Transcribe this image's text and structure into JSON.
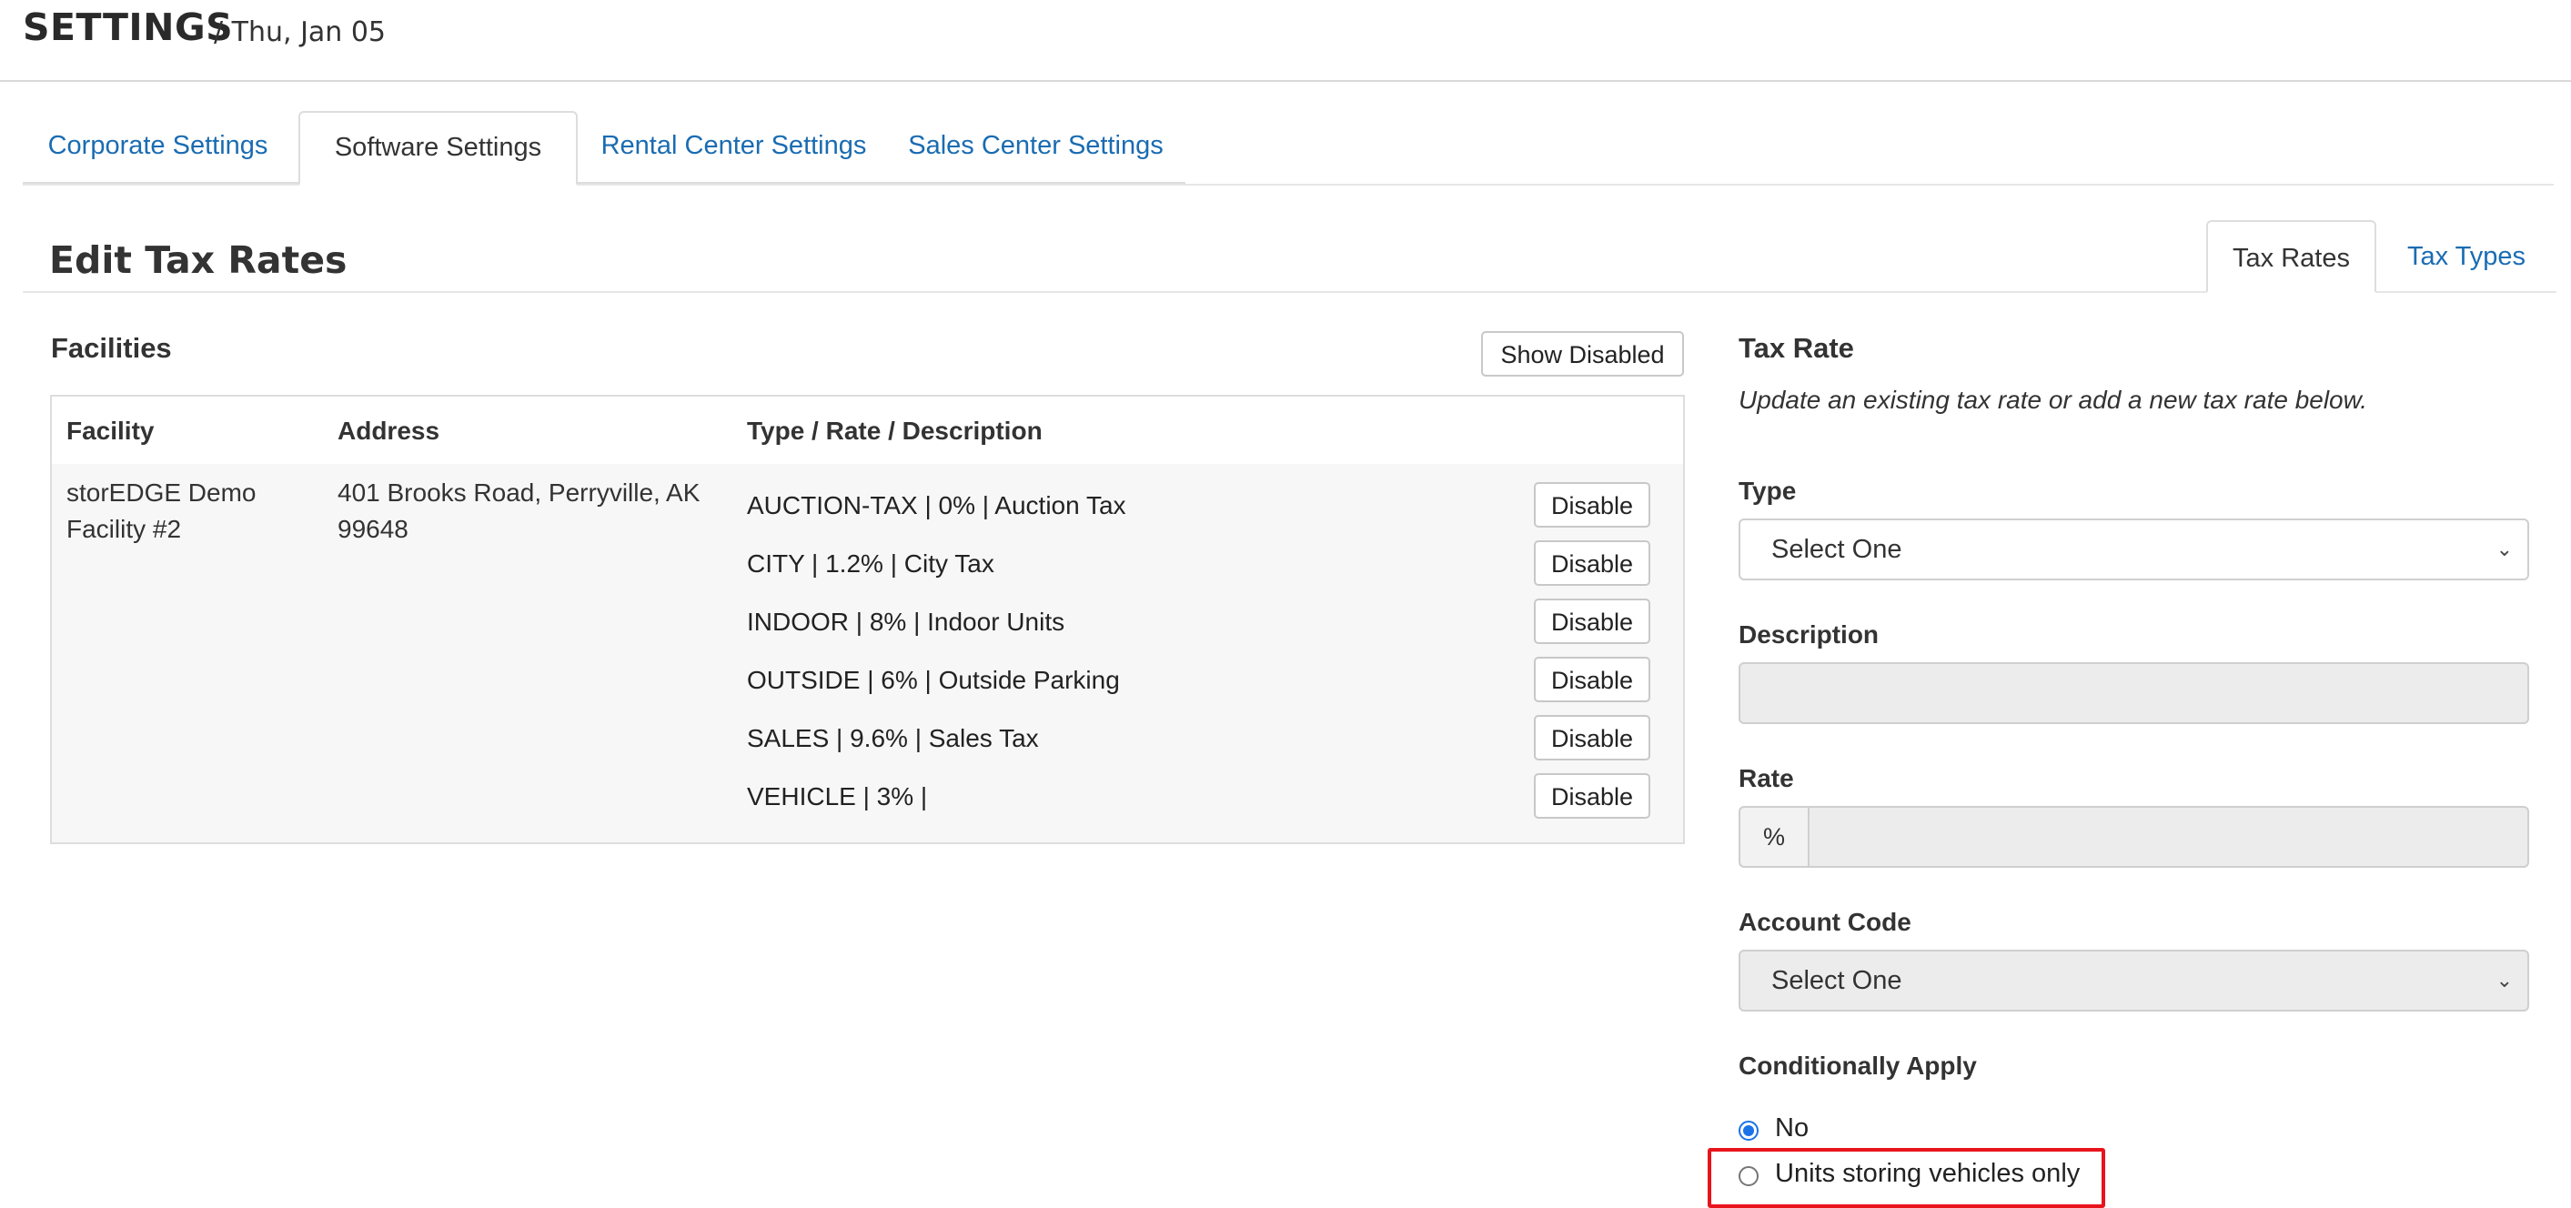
{
  "header": {
    "title": "SETTINGS",
    "date": "/ Thu, Jan 05"
  },
  "main_tabs": [
    {
      "label": "Corporate Settings",
      "active": false
    },
    {
      "label": "Software Settings",
      "active": true
    },
    {
      "label": "Rental Center Settings",
      "active": false
    },
    {
      "label": "Sales Center Settings",
      "active": false
    }
  ],
  "section": {
    "title": "Edit Tax Rates",
    "tabs": [
      {
        "label": "Tax Rates",
        "active": true
      },
      {
        "label": "Tax Types",
        "active": false
      }
    ]
  },
  "facilities": {
    "title": "Facilities",
    "show_disabled_label": "Show Disabled",
    "columns": [
      "Facility",
      "Address",
      "Type / Rate / Description"
    ],
    "rows": [
      {
        "facility_line1": "storEDGE Demo",
        "facility_line2": "Facility #2",
        "address_line1": "401 Brooks Road, Perryville, AK",
        "address_line2": "99648",
        "rates": [
          {
            "text": "AUCTION-TAX | 0% | Auction Tax",
            "button": "Disable"
          },
          {
            "text": "CITY | 1.2% | City Tax",
            "button": "Disable"
          },
          {
            "text": "INDOOR | 8% | Indoor Units",
            "button": "Disable"
          },
          {
            "text": "OUTSIDE | 6% | Outside Parking",
            "button": "Disable"
          },
          {
            "text": "SALES | 9.6% | Sales Tax",
            "button": "Disable"
          },
          {
            "text": "VEHICLE | 3% |",
            "button": "Disable"
          }
        ]
      }
    ]
  },
  "form": {
    "title": "Tax Rate",
    "subtitle": "Update an existing tax rate or add a new tax rate below.",
    "type_label": "Type",
    "type_value": "Select One",
    "description_label": "Description",
    "description_value": "",
    "rate_label": "Rate",
    "rate_addon": "%",
    "rate_value": "",
    "account_code_label": "Account Code",
    "account_code_value": "Select One",
    "conditional_label": "Conditionally Apply",
    "conditional_options": [
      {
        "label": "No",
        "checked": true
      },
      {
        "label": "Units storing vehicles only",
        "checked": false
      }
    ]
  },
  "colors": {
    "link": "#1a6cb2",
    "highlight": "#e8141c",
    "radio_checked": "#1a73e8"
  },
  "icons": {
    "select_chevron": "chevron-down-icon"
  }
}
